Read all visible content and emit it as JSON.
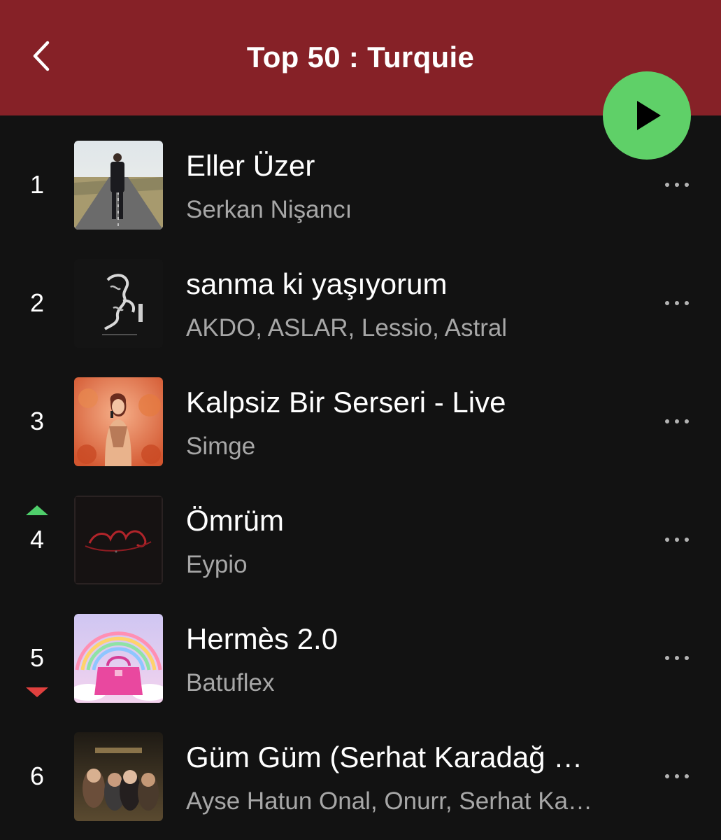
{
  "header": {
    "title": "Top 50 : Turquie",
    "back_icon": "chevron-left-icon",
    "background": "#862127"
  },
  "play_button": {
    "icon": "play-icon",
    "color": "#5fd068"
  },
  "tracks": [
    {
      "rank": "1",
      "title": "Eller Üzer",
      "artist": "Serkan Nişancı",
      "trend": "none"
    },
    {
      "rank": "2",
      "title": "sanma ki yaşıyorum",
      "artist": "AKDO, ASLAR, Lessio, Astral",
      "trend": "none"
    },
    {
      "rank": "3",
      "title": "Kalpsiz Bir Serseri - Live",
      "artist": "Simge",
      "trend": "none"
    },
    {
      "rank": "4",
      "title": "Ömrüm",
      "artist": "Eypio",
      "trend": "up"
    },
    {
      "rank": "5",
      "title": "Hermès 2.0",
      "artist": "Batuflex",
      "trend": "down"
    },
    {
      "rank": "6",
      "title": "Güm Güm (Serhat Karadağ Remix)",
      "artist": "Ayse Hatun Onal, Onurr, Serhat Karadağ",
      "trend": "none"
    }
  ],
  "colors": {
    "background": "#121212",
    "trend_up": "#4fcf6b",
    "trend_down": "#e0403e",
    "secondary_text": "#a7a7a7"
  }
}
